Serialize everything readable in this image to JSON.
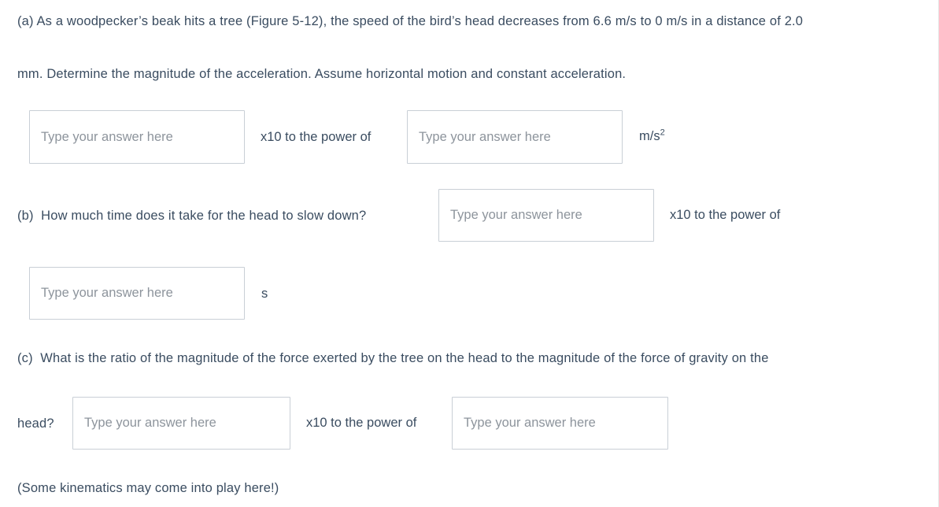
{
  "question": {
    "part_a": {
      "label": "(a)",
      "text_line1": "(a) As a woodpecker’s beak hits a tree (Figure 5-12), the speed of the bird’s head decreases from 6.6 m/s to 0 m/s in a distance of 2.0",
      "text_line2": "mm. Determine the magnitude of the acceleration. Assume horizontal motion and constant acceleration.",
      "input_mantissa_placeholder": "Type your answer here",
      "power_label": "x10 to the power of",
      "input_exponent_placeholder": "Type your answer here",
      "unit_base": "m/s",
      "unit_exponent": "2"
    },
    "part_b": {
      "prompt": "(b)  How much time does it take for the head to slow down?",
      "input_mantissa_placeholder": "Type your answer here",
      "power_label": "x10 to the power of",
      "input_exponent_placeholder": "Type your answer here",
      "unit": "s"
    },
    "part_c": {
      "prompt_line1": "(c)  What is the ratio of the magnitude of the force exerted by the tree on the head to the magnitude of the force of gravity on the",
      "prompt_line2": "head?",
      "input_mantissa_placeholder": "Type your answer here",
      "power_label": "x10 to the power of",
      "input_exponent_placeholder": "Type your answer here"
    },
    "hint": "(Some kinematics may come into play here!)"
  },
  "colors": {
    "text": "#3a4c60",
    "placeholder": "#8d949c",
    "input_border": "#c9cfd6",
    "background": "#ffffff"
  }
}
